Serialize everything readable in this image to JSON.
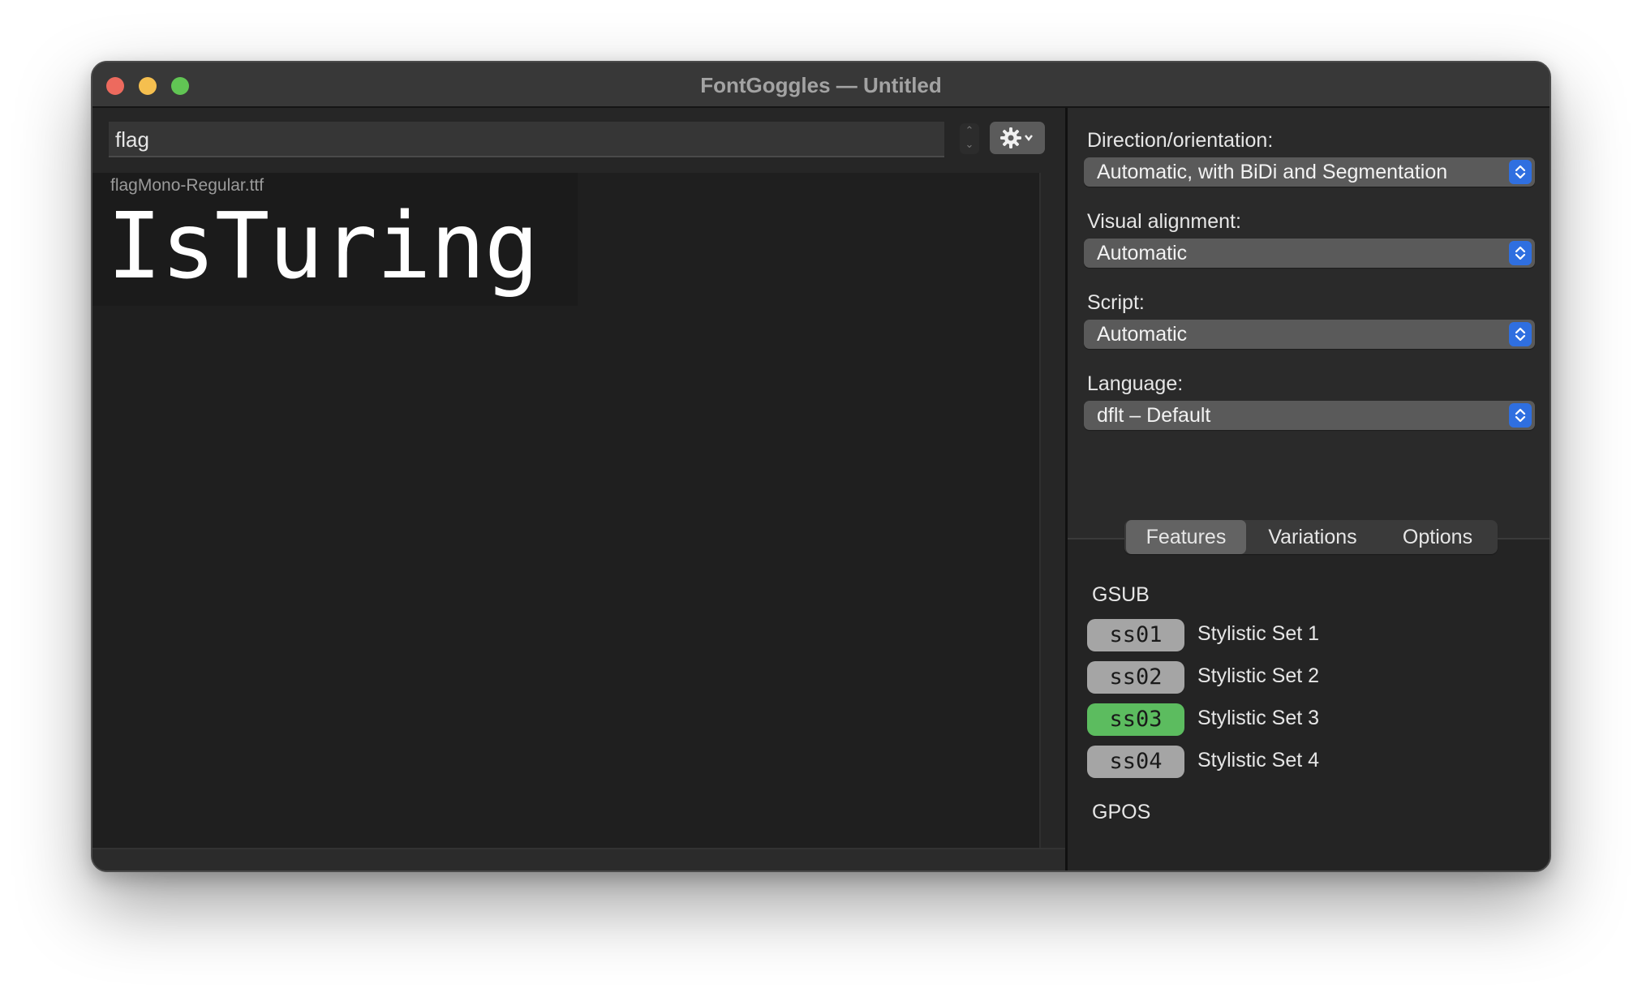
{
  "window": {
    "title": "FontGoggles — Untitled"
  },
  "toolbar": {
    "text_value": "flag",
    "stepper_up": "⌃",
    "stepper_down": "⌄"
  },
  "preview": {
    "font_filename": "flagMono-Regular.ttf",
    "sample_text": "IsTuring"
  },
  "settings": {
    "direction": {
      "label": "Direction/orientation:",
      "value": "Automatic, with BiDi and Segmentation"
    },
    "alignment": {
      "label": "Visual alignment:",
      "value": "Automatic"
    },
    "script": {
      "label": "Script:",
      "value": "Automatic"
    },
    "language": {
      "label": "Language:",
      "value": "dflt – Default"
    }
  },
  "tabs": [
    {
      "label": "Features",
      "active": true
    },
    {
      "label": "Variations",
      "active": false
    },
    {
      "label": "Options",
      "active": false
    }
  ],
  "features": {
    "gsub_title": "GSUB",
    "gpos_title": "GPOS",
    "items": [
      {
        "tag": "ss01",
        "name": "Stylistic Set 1",
        "enabled": false
      },
      {
        "tag": "ss02",
        "name": "Stylistic Set 2",
        "enabled": false
      },
      {
        "tag": "ss03",
        "name": "Stylistic Set 3",
        "enabled": true
      },
      {
        "tag": "ss04",
        "name": "Stylistic Set 4",
        "enabled": false
      }
    ]
  },
  "colors": {
    "close": "#ed6a5e",
    "minimize": "#f5bf4f",
    "maximize": "#61c554",
    "accent": "#2f6fe0",
    "feature_on": "#5cbc5f",
    "feature_off": "#a5a5a5"
  }
}
